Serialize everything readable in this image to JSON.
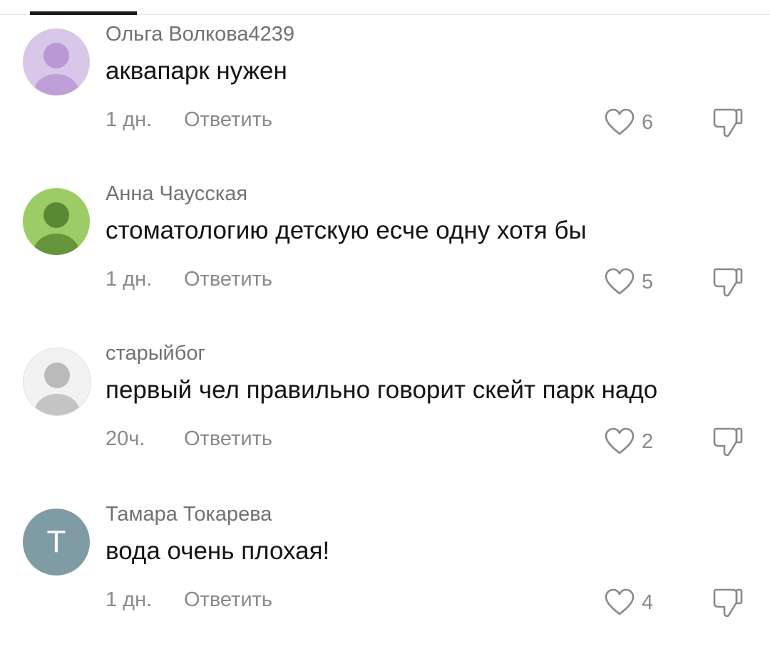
{
  "ui": {
    "colors": {
      "text": "#141414",
      "muted": "#8a8a8a",
      "author": "#727272",
      "divider": "#e6e6e6"
    },
    "icons": {
      "like": "heart-outline-icon",
      "dislike": "thumbs-down-outline-icon"
    }
  },
  "comments": [
    {
      "author": "Ольга Волкова4239",
      "text": "аквапарк нужен",
      "time": "1 дн.",
      "reply_label": "Ответить",
      "likes": "6",
      "avatar": {
        "kind": "photo",
        "colors": [
          "#d8c7e8",
          "#b48fd0"
        ]
      }
    },
    {
      "author": "Анна Чаусская",
      "text": "стоматологию детскую есче одну хотя бы",
      "time": "1 дн.",
      "reply_label": "Ответить",
      "likes": "5",
      "avatar": {
        "kind": "photo",
        "colors": [
          "#9ccc65",
          "#4e7d2a"
        ]
      }
    },
    {
      "author": "старыйбог",
      "text": "первый чел правильно говорит скейт парк надо",
      "time": "20ч.",
      "reply_label": "Ответить",
      "likes": "2",
      "avatar": {
        "kind": "drawing",
        "colors": [
          "#f2f2f2",
          "#b0b0b0"
        ]
      }
    },
    {
      "author": "Тамара Токарева",
      "text": "вода очень плохая!",
      "time": "1 дн.",
      "reply_label": "Ответить",
      "likes": "4",
      "avatar": {
        "kind": "letter",
        "letter": "Т",
        "colors": [
          "#7f9ba3",
          "#7f9ba3"
        ]
      }
    }
  ]
}
